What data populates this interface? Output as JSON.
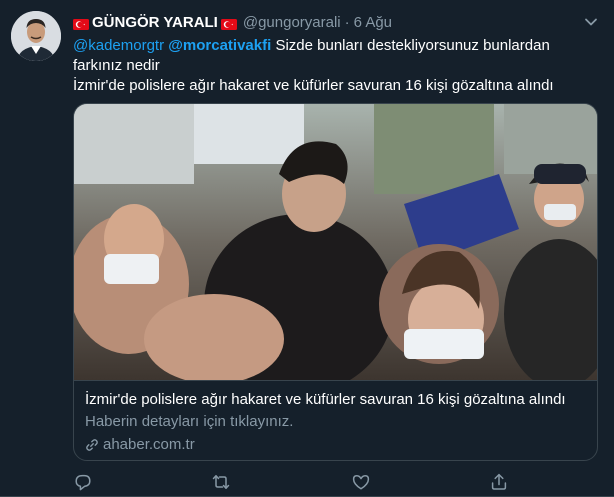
{
  "tweet": {
    "display_name": "GÜNGÖR YARALI",
    "handle": "@gungoryarali",
    "separator": "·",
    "time": "6 Ağu",
    "reply_to_1": "@kademorgtr",
    "reply_to_2": "@morcativakfi",
    "text_line_1": "Sizde bunları destekliyorsunuz bunlardan",
    "text_line_2": "farkınız nedir",
    "text_line_3": "İzmir'de polislere ağır hakaret ve küfürler savuran 16 kişi gözaltına alındı"
  },
  "card": {
    "title": "İzmir'de polislere ağır hakaret ve küfürler savuran 16 kişi gözaltına alındı",
    "description": "Haberin detayları için tıklayınız.",
    "domain": "ahaber.com.tr"
  },
  "icons": {
    "flag": "turkey-flag-icon",
    "more": "chevron-down-icon",
    "reply": "reply-icon",
    "retweet": "retweet-icon",
    "like": "like-icon",
    "share": "share-icon",
    "link": "link-icon"
  },
  "colors": {
    "background": "#15202b",
    "text": "#ffffff",
    "secondary": "#8899a6",
    "accent": "#1da1f2",
    "border": "#38444d",
    "flag_red": "#e30a17"
  }
}
